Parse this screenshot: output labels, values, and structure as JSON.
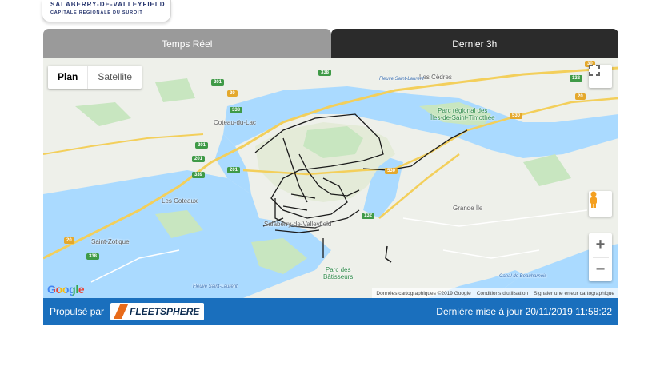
{
  "logo": {
    "line1": "SALABERRY-DE-VALLEYFIELD",
    "line2": "CAPITALE RÉGIONALE DU SUROÎT"
  },
  "tabs": [
    {
      "label": "Temps Réel",
      "active": false
    },
    {
      "label": "Dernier 3h",
      "active": true
    }
  ],
  "map": {
    "type_buttons": {
      "plan": "Plan",
      "satellite": "Satellite"
    },
    "google": "Google",
    "attribution": {
      "data": "Données cartographiques ©2019 Google",
      "terms": "Conditions d'utilisation",
      "report": "Signaler une erreur cartographique"
    },
    "places": {
      "coteau": "Coteau-du-Lac",
      "cedres": "Les Cèdres",
      "park1": "Parc régional des",
      "park2": "Îles-de-Saint-Timothée",
      "coteaux": "Les Coteaux",
      "grande_ile": "Grande Île",
      "zotique": "Saint-Zotique",
      "valleyfield": "Salaberry-de-Valleyfield",
      "batisseurs1": "Parc des",
      "batisseurs2": "Bâtisseurs",
      "fleuve1": "Fleuve Saint-Laurent",
      "fleuve2": "Fleuve Saint-Laurent",
      "canal": "Canal de Beauharnois"
    },
    "routes": {
      "r338": "338",
      "r201a": "201",
      "r20": "20",
      "r338b": "338",
      "r201b": "201",
      "r201c": "201",
      "r339": "339",
      "r201d": "201",
      "r20b": "20",
      "r338c": "338",
      "r132a": "132",
      "r530": "530",
      "r20c": "20",
      "r30": "30",
      "r132b": "132",
      "r530b": "530"
    },
    "controls": {
      "zoom_in": "+",
      "zoom_out": "−"
    }
  },
  "footer": {
    "powered_by": "Propulsé par",
    "brand": "FLEETSPHERE",
    "last_update": "Dernière mise à jour 20/11/2019 11:58:22"
  },
  "colors": {
    "footer_bg": "#1a6fbd",
    "tab_inactive": "#9a9a9a",
    "tab_active": "#2b2b2b",
    "water": "#aadaff",
    "park": "#c8e6c0"
  }
}
